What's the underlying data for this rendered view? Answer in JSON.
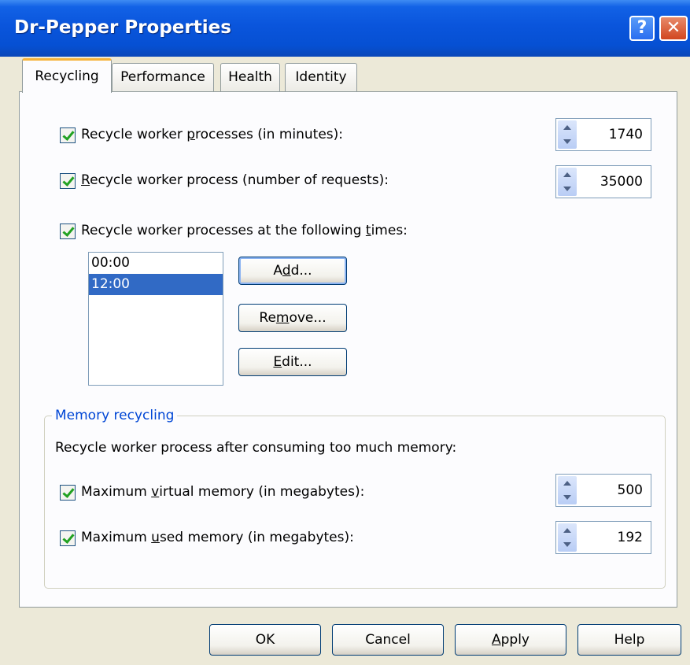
{
  "window": {
    "title": "Dr-Pepper Properties",
    "help_glyph": "?",
    "close_glyph": "✕"
  },
  "tabs": [
    {
      "label": "Recycling",
      "active": true
    },
    {
      "label": "Performance",
      "active": false
    },
    {
      "label": "Health",
      "active": false
    },
    {
      "label": "Identity",
      "active": false
    }
  ],
  "recycling": {
    "minutes": {
      "checked": true,
      "pre": "Recycle worker ",
      "ul": "p",
      "post": "rocesses (in minutes):",
      "value": "1740"
    },
    "requests": {
      "checked": true,
      "pre": "",
      "ul": "R",
      "post": "ecycle worker process (number of requests):",
      "value": "35000"
    },
    "times": {
      "checked": true,
      "pre": "Recycle worker processes at the following ",
      "ul": "t",
      "post": "imes:"
    },
    "time_list": [
      "00:00",
      "12:00"
    ],
    "selected_time": "12:00",
    "buttons": {
      "add": {
        "pre": "A",
        "ul": "d",
        "post": "d..."
      },
      "remove": {
        "pre": "Re",
        "ul": "m",
        "post": "ove..."
      },
      "edit": {
        "pre": "",
        "ul": "E",
        "post": "dit..."
      }
    }
  },
  "memory": {
    "group_title": "Memory recycling",
    "description": "Recycle worker process after consuming too much memory:",
    "virtual": {
      "checked": true,
      "pre": "Maximum ",
      "ul": "v",
      "post": "irtual memory (in megabytes):",
      "value": "500"
    },
    "used": {
      "checked": true,
      "pre": "Maximum ",
      "ul": "u",
      "post": "sed memory (in megabytes):",
      "value": "192"
    }
  },
  "footer": {
    "ok": "OK",
    "cancel": "Cancel",
    "apply": {
      "pre": "",
      "ul": "A",
      "post": "pply"
    },
    "help": "Help"
  },
  "colors": {
    "titlebar": "#0a55dc",
    "selection": "#316ac5",
    "group_title": "#0046d5",
    "active_tab_accent": "#f5b339",
    "checkmark": "#21a121"
  }
}
